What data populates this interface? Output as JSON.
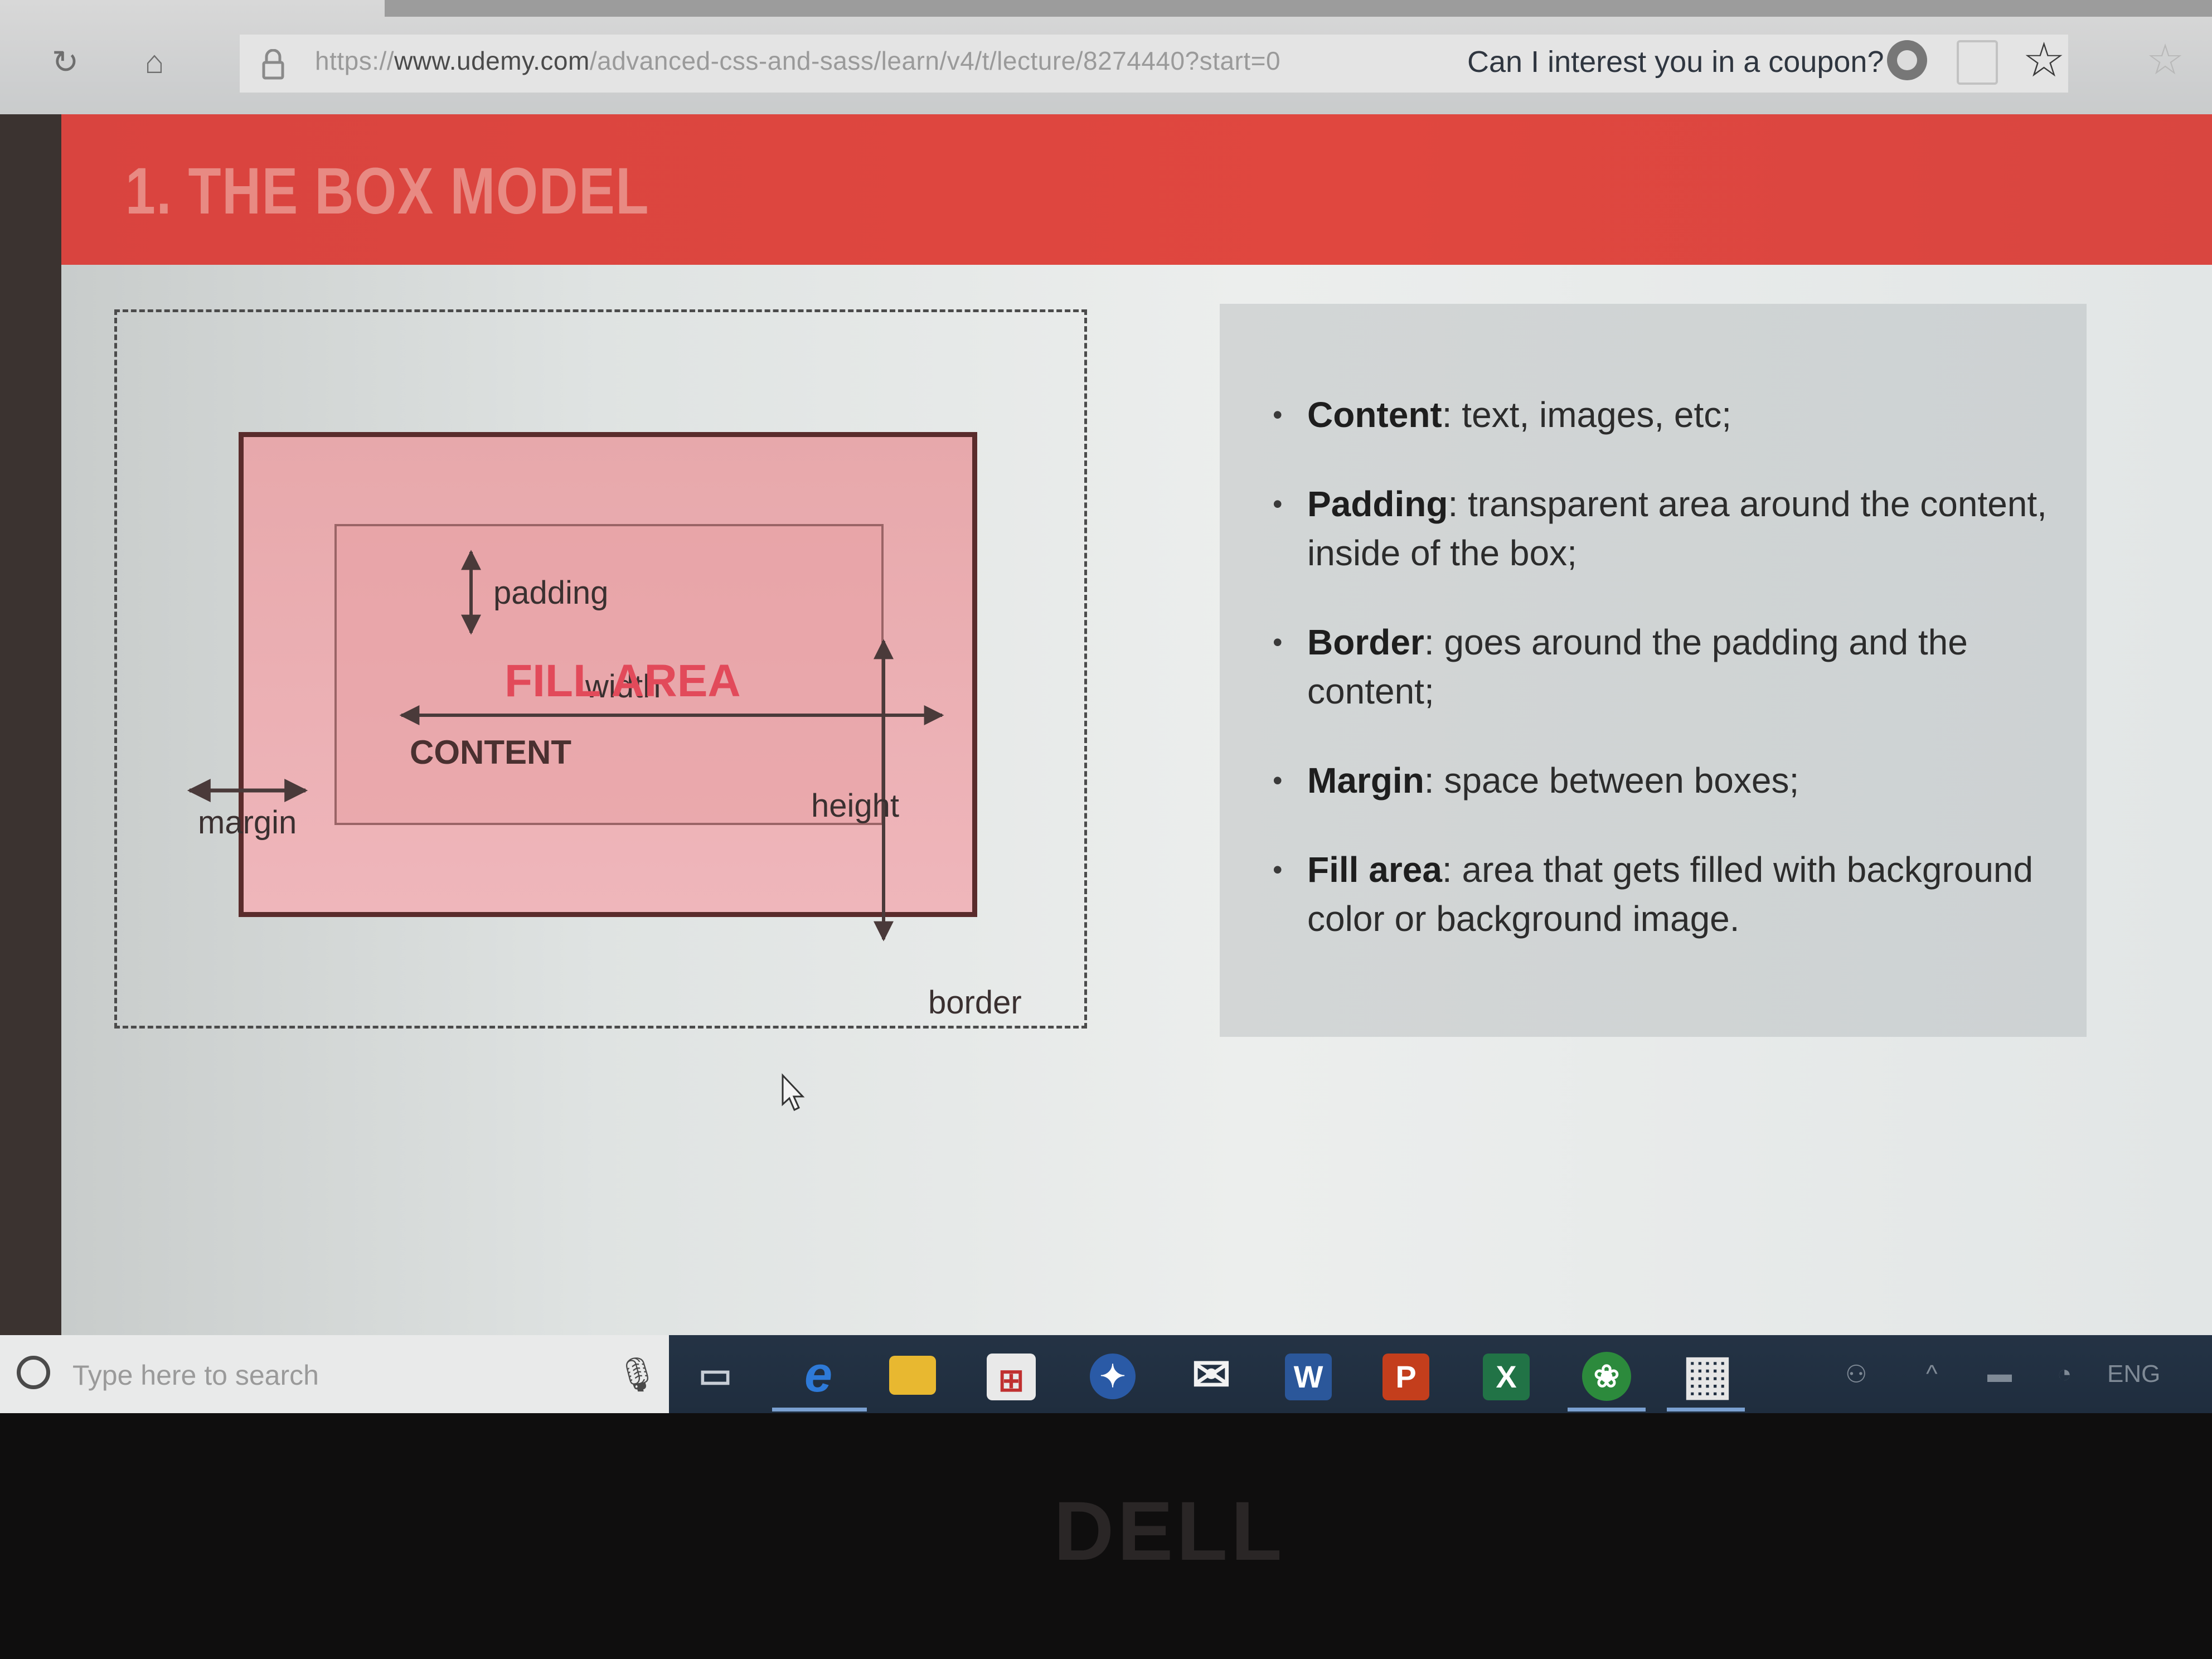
{
  "browser": {
    "url_prefix": "https://",
    "url_host": "www.udemy.com",
    "url_path": "/advanced-css-and-sass/learn/v4/t/lecture/8274440?start=0",
    "coupon_text": "Can I interest you in a coupon?",
    "icons": [
      "refresh-icon",
      "home-icon",
      "lock-icon",
      "extension-icon",
      "reading-icon",
      "star-icon",
      "favorites-icon"
    ]
  },
  "slide": {
    "title": "1. THE BOX MODEL",
    "header_color": "#de453f",
    "diagram": {
      "padding_label": "padding",
      "width_label": "width",
      "fill_area_label": "FILL AREA",
      "height_label": "height",
      "content_label": "CONTENT",
      "margin_label": "margin",
      "border_label": "border",
      "fill_color": "#e24a5a"
    },
    "bullets": [
      {
        "term": "Content",
        "text": ": text, images, etc;"
      },
      {
        "term": "Padding",
        "text": ": transparent area around the content, inside of the box;"
      },
      {
        "term": "Border",
        "text": ": goes around the padding and the content;"
      },
      {
        "term": "Margin",
        "text": ": space between boxes;"
      },
      {
        "term": "Fill area",
        "text": ": area that gets filled with background color or background image."
      }
    ]
  },
  "taskbar": {
    "search_placeholder": "Type here to search",
    "apps": [
      {
        "name": "task-view",
        "glyph": "▭"
      },
      {
        "name": "edge",
        "glyph": "e"
      },
      {
        "name": "file-explorer",
        "glyph": "▬"
      },
      {
        "name": "store",
        "glyph": "⊞"
      },
      {
        "name": "app-blue",
        "glyph": "✦"
      },
      {
        "name": "mail",
        "glyph": "✉"
      },
      {
        "name": "word",
        "glyph": "W"
      },
      {
        "name": "powerpoint",
        "glyph": "P"
      },
      {
        "name": "excel",
        "glyph": "X"
      },
      {
        "name": "app-green",
        "glyph": "❀"
      },
      {
        "name": "calculator",
        "glyph": "▦"
      }
    ],
    "tray_lang": "ENG"
  },
  "bezel": {
    "brand": "DELL"
  }
}
